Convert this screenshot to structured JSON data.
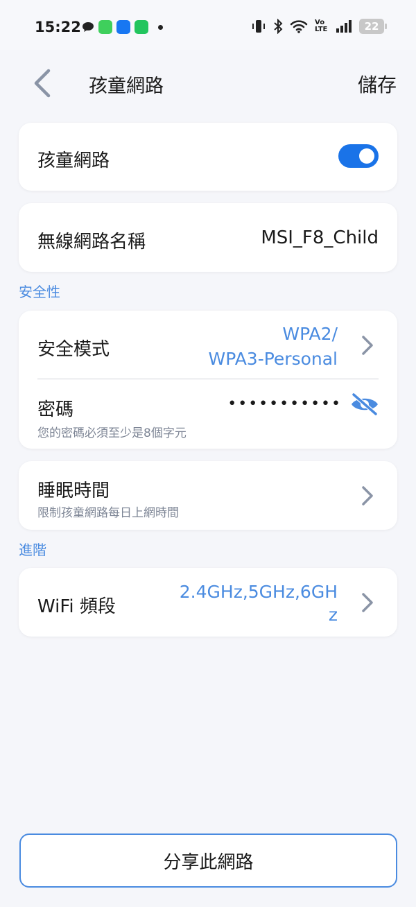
{
  "status_bar": {
    "time": "15:22",
    "battery": "22",
    "app_icons": [
      "message-icon",
      "line-icon",
      "facebook-icon",
      "calendar-icon"
    ],
    "right_icons": [
      "vibrate-icon",
      "bluetooth-icon",
      "wifi-icon",
      "volte-icon",
      "signal-icon",
      "battery-icon"
    ],
    "volte_label": "Vo LTE"
  },
  "header": {
    "title": "孩童網路",
    "save_label": "儲存"
  },
  "child_network": {
    "label": "孩童網路",
    "enabled": true
  },
  "ssid": {
    "label": "無線網路名稱",
    "value": "MSI_F8_Child"
  },
  "security_section": {
    "title": "安全性",
    "mode_label": "安全模式",
    "mode_value_line1": "WPA2/",
    "mode_value_line2": "WPA3-Personal",
    "password_label": "密碼",
    "password_hint": "您的密碼必須至少是8個字元",
    "password_masked": "•••••••••••"
  },
  "sleep": {
    "label": "睡眠時間",
    "hint": "限制孩童網路每日上網時間"
  },
  "advanced_section": {
    "title": "進階",
    "band_label": "WiFi 頻段",
    "band_value_line1": "2.4GHz,5GHz,6GH",
    "band_value_line2": "z"
  },
  "share_button": {
    "label": "分享此網路"
  },
  "colors": {
    "accent": "#4a8be0",
    "toggle_on": "#1a73e8",
    "background": "#f5f6fa"
  }
}
